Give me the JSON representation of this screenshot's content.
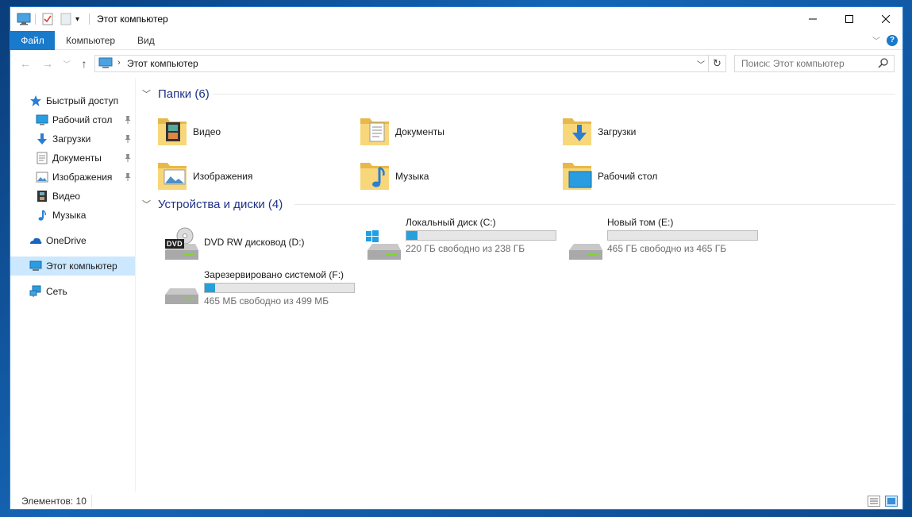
{
  "window": {
    "title": "Этот компьютер"
  },
  "ribbon": {
    "tabs": [
      "Файл",
      "Компьютер",
      "Вид"
    ],
    "help": "?"
  },
  "address": {
    "path": "Этот компьютер"
  },
  "search": {
    "placeholder": "Поиск: Этот компьютер"
  },
  "sidebar": {
    "items": [
      {
        "label": "Быстрый доступ",
        "icon": "star-icon"
      },
      {
        "label": "Рабочий стол",
        "icon": "desktop-icon",
        "pinned": true
      },
      {
        "label": "Загрузки",
        "icon": "download-icon",
        "pinned": true
      },
      {
        "label": "Документы",
        "icon": "documents-icon",
        "pinned": true
      },
      {
        "label": "Изображения",
        "icon": "pictures-icon",
        "pinned": true
      },
      {
        "label": "Видео",
        "icon": "video-icon"
      },
      {
        "label": "Музыка",
        "icon": "music-icon"
      },
      {
        "label": "OneDrive",
        "icon": "onedrive-icon"
      },
      {
        "label": "Этот компьютер",
        "icon": "computer-icon",
        "selected": true
      },
      {
        "label": "Сеть",
        "icon": "network-icon"
      }
    ]
  },
  "folders": {
    "header": "Папки (6)",
    "items": [
      {
        "label": "Видео",
        "icon": "video-folder-icon"
      },
      {
        "label": "Документы",
        "icon": "documents-folder-icon"
      },
      {
        "label": "Загрузки",
        "icon": "downloads-folder-icon"
      },
      {
        "label": "Изображения",
        "icon": "pictures-folder-icon"
      },
      {
        "label": "Музыка",
        "icon": "music-folder-icon"
      },
      {
        "label": "Рабочий стол",
        "icon": "desktop-folder-icon"
      }
    ]
  },
  "devices": {
    "header": "Устройства и диски (4)",
    "items": [
      {
        "label": "DVD RW дисковод (D:)",
        "icon": "dvd-drive-icon",
        "dvd_badge": "DVD"
      },
      {
        "label": "Локальный диск (C:)",
        "free": "220 ГБ свободно из 238 ГБ",
        "used_fraction": 0.076,
        "icon": "system-drive-icon"
      },
      {
        "label": "Новый том (E:)",
        "free": "465 ГБ свободно из 465 ГБ",
        "used_fraction": 0.0,
        "icon": "hard-drive-icon"
      },
      {
        "label": "Зарезервировано системой (F:)",
        "free": "465 МБ свободно из 499 МБ",
        "used_fraction": 0.068,
        "icon": "hard-drive-icon"
      }
    ]
  },
  "status": {
    "items_count": "Элементов: 10"
  },
  "colors": {
    "accent": "#1979ca",
    "bar_fill": "#26a0da",
    "selected_bg": "#cce8ff",
    "header_text": "#1e3287"
  }
}
